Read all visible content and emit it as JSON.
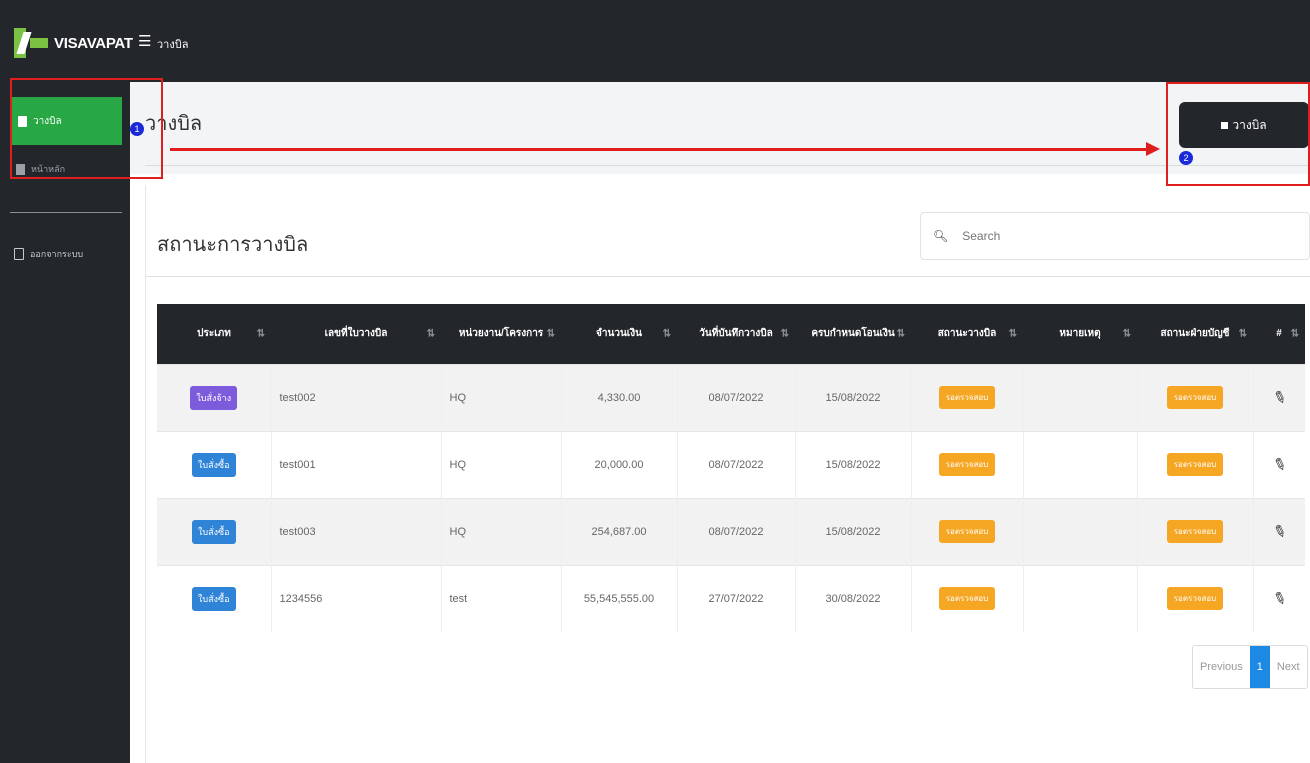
{
  "brand": {
    "name": "VISAVAPAT"
  },
  "topbar": {
    "menu_icon": "hamburger-icon",
    "title": "วางบิล"
  },
  "sidebar": {
    "items": [
      {
        "label": "วางบิล",
        "icon": "document-icon",
        "active": true
      },
      {
        "label": "หน้าหลัก",
        "icon": "document-icon",
        "active": false
      }
    ],
    "logout_label": "ออกจากระบบ"
  },
  "page": {
    "title": "วางบิล",
    "add_button_label": "วางบิล"
  },
  "section": {
    "title": "สถานะการวางบิล",
    "search_placeholder": "Search"
  },
  "table": {
    "headers": [
      "ประเภท",
      "เลขที่ใบวางบิล",
      "หน่วยงาน/โครงการ",
      "จำนวนเงิน",
      "วันที่บันทึกวางบิล",
      "ครบกำหนดโอนเงิน",
      "สถานะวางบิล",
      "หมายเหตุ",
      "สถานะฝ่ายบัญชี",
      "#"
    ],
    "rows": [
      {
        "type": "ใบสั่งจ้าง",
        "type_color": "#7c5cdb",
        "bill_no": "test002",
        "unit": "HQ",
        "amount": "4,330.00",
        "record_date": "08/07/2022",
        "due_date": "15/08/2022",
        "status": "รอตรวจสอบ",
        "note": "",
        "account_status": "รอตรวจสอบ"
      },
      {
        "type": "ใบสั่งซื้อ",
        "type_color": "#2f84d8",
        "bill_no": "test001",
        "unit": "HQ",
        "amount": "20,000.00",
        "record_date": "08/07/2022",
        "due_date": "15/08/2022",
        "status": "รอตรวจสอบ",
        "note": "",
        "account_status": "รอตรวจสอบ"
      },
      {
        "type": "ใบสั่งซื้อ",
        "type_color": "#2f84d8",
        "bill_no": "test003",
        "unit": "HQ",
        "amount": "254,687.00",
        "record_date": "08/07/2022",
        "due_date": "15/08/2022",
        "status": "รอตรวจสอบ",
        "note": "",
        "account_status": "รอตรวจสอบ"
      },
      {
        "type": "ใบสั่งซื้อ",
        "type_color": "#2f84d8",
        "bill_no": "1234556",
        "unit": "test",
        "amount": "55,545,555.00",
        "record_date": "27/07/2022",
        "due_date": "30/08/2022",
        "status": "รอตรวจสอบ",
        "note": "",
        "account_status": "รอตรวจสอบ"
      }
    ]
  },
  "pagination": {
    "previous": "Previous",
    "current": "1",
    "next": "Next"
  },
  "annotations": {
    "step1": "1",
    "step2": "2",
    "highlight_color": "#e01e1e"
  }
}
